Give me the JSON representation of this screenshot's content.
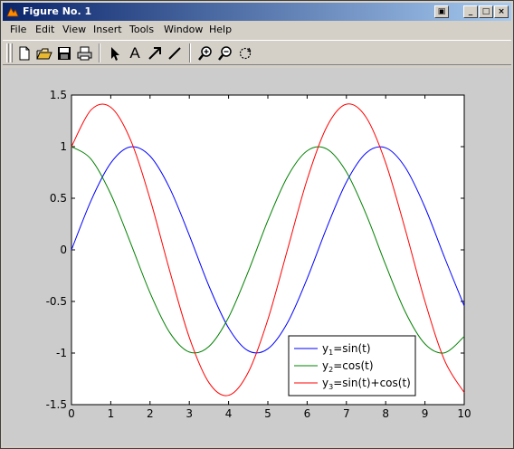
{
  "window": {
    "title": "Figure No. 1",
    "controls": {
      "minimize": "_",
      "maximize": "□",
      "close": "×"
    }
  },
  "menu": [
    "File",
    "Edit",
    "View",
    "Insert",
    "Tools",
    "Window",
    "Help"
  ],
  "toolbar": {
    "icons": [
      "new-file-icon",
      "open-folder-icon",
      "save-icon",
      "print-icon",
      "select-arrow-icon",
      "insert-text-icon",
      "insert-arrow-icon",
      "insert-line-icon",
      "zoom-in-icon",
      "zoom-out-icon",
      "rotate-icon"
    ],
    "text_tool_label": "A"
  },
  "chart_data": {
    "type": "line",
    "title": "",
    "xlabel": "",
    "ylabel": "",
    "xlim": [
      0,
      10
    ],
    "ylim": [
      -1.5,
      1.5
    ],
    "xticks": [
      0,
      1,
      2,
      3,
      4,
      5,
      6,
      7,
      8,
      9,
      10
    ],
    "xtick_labels": [
      "0",
      "1",
      "2",
      "3",
      "4",
      "5",
      "6",
      "7",
      "8",
      "9",
      "10"
    ],
    "yticks": [
      -1.5,
      -1,
      -0.5,
      0,
      0.5,
      1,
      1.5
    ],
    "ytick_labels": [
      "-1.5",
      "-1",
      "-0.5",
      "0",
      "0.5",
      "1",
      "1.5"
    ],
    "grid": false,
    "legend_position": "bottom-right",
    "x": [
      0,
      0.5,
      1,
      1.5,
      2,
      2.5,
      3,
      3.5,
      4,
      4.5,
      5,
      5.5,
      6,
      6.5,
      7,
      7.5,
      8,
      8.5,
      9,
      9.5,
      10
    ],
    "series": [
      {
        "name_base": "y",
        "name_sub": "1",
        "name_rest": "=sin(t)",
        "color": "#0000ff",
        "values": [
          0,
          0.479,
          0.841,
          0.997,
          0.909,
          0.598,
          0.141,
          -0.351,
          -0.757,
          -0.978,
          -0.959,
          -0.706,
          -0.279,
          0.215,
          0.657,
          0.938,
          0.989,
          0.798,
          0.412,
          -0.075,
          -0.544
        ]
      },
      {
        "name_base": "y",
        "name_sub": "2",
        "name_rest": "=cos(t)",
        "color": "#008000",
        "values": [
          1,
          0.878,
          0.54,
          0.071,
          -0.416,
          -0.801,
          -0.99,
          -0.936,
          -0.654,
          -0.211,
          0.284,
          0.709,
          0.96,
          0.977,
          0.754,
          0.347,
          -0.146,
          -0.602,
          -0.911,
          -0.997,
          -0.839
        ]
      },
      {
        "name_base": "y",
        "name_sub": "3",
        "name_rest": "=sin(t)+cos(t)",
        "color": "#ff0000",
        "values": [
          1,
          1.357,
          1.382,
          1.068,
          0.493,
          -0.203,
          -0.849,
          -1.287,
          -1.41,
          -1.188,
          -0.675,
          0.003,
          0.681,
          1.192,
          1.411,
          1.285,
          0.843,
          0.196,
          -0.499,
          -1.072,
          -1.383
        ]
      }
    ]
  }
}
